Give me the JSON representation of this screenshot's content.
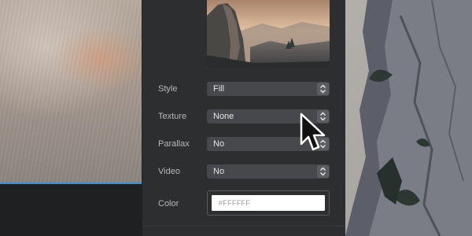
{
  "inspector": {
    "rows": [
      {
        "key": "style",
        "label": "Style",
        "value": "Fill"
      },
      {
        "key": "texture",
        "label": "Texture",
        "value": "None"
      },
      {
        "key": "parallax",
        "label": "Parallax",
        "value": "No"
      },
      {
        "key": "video",
        "label": "Video",
        "value": "No"
      }
    ],
    "color": {
      "label": "Color",
      "placeholder": "#FFFFFF"
    }
  },
  "theme": {
    "accent": "#3b8fd8",
    "panel_bg": "#2d2e30",
    "select_bg": "#47484b"
  },
  "icons": {
    "stepper": "updown-chevron-icon",
    "cursor": "mouse-pointer-icon"
  }
}
